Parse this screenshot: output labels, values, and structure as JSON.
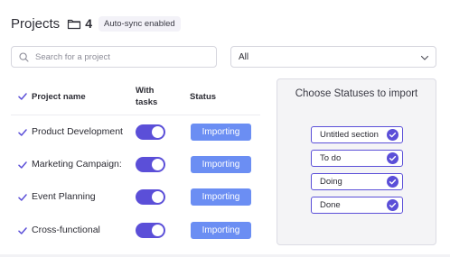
{
  "header": {
    "title": "Projects",
    "count": "4",
    "badge": "Auto-sync enabled",
    "icon": "folder-icon"
  },
  "search": {
    "placeholder": "Search for a project",
    "value": ""
  },
  "filter": {
    "selected": "All"
  },
  "table": {
    "columns": {
      "name": "Project name",
      "tasks_line1": "With",
      "tasks_line2": "tasks",
      "status": "Status"
    },
    "rows": [
      {
        "name": "Product Development",
        "checked": true,
        "with_tasks": true,
        "status": "Importing"
      },
      {
        "name": "Marketing Campaign:",
        "checked": true,
        "with_tasks": true,
        "status": "Importing"
      },
      {
        "name": "Event Planning",
        "checked": true,
        "with_tasks": true,
        "status": "Importing"
      },
      {
        "name": "Cross-functional",
        "checked": true,
        "with_tasks": true,
        "status": "Importing"
      }
    ]
  },
  "statuses_panel": {
    "title": "Choose Statuses to import",
    "items": [
      {
        "label": "Untitled section",
        "checked": true
      },
      {
        "label": "To do",
        "checked": true
      },
      {
        "label": "Doing",
        "checked": true
      },
      {
        "label": "Done",
        "checked": true
      }
    ]
  },
  "colors": {
    "accent": "#5b4fd8",
    "status_button": "#6b8ef3",
    "panel_bg": "#f4f4f6"
  }
}
